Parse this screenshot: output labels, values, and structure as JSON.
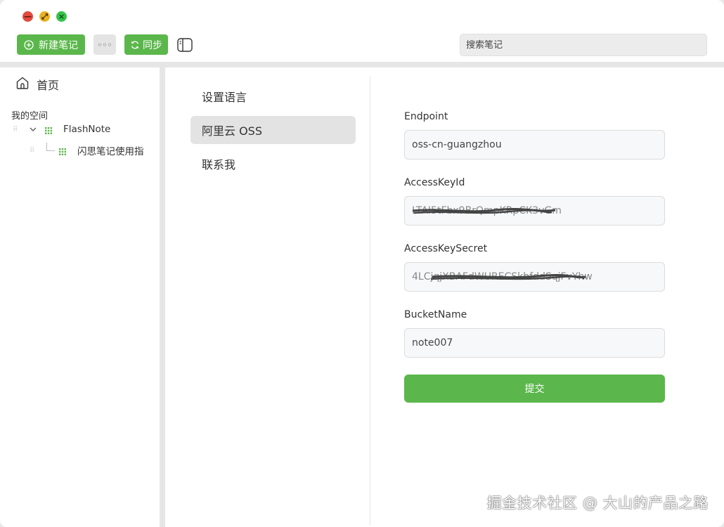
{
  "toolbar": {
    "new_note_label": "新建笔记",
    "more_label": "◦◦◦",
    "sync_label": "同步"
  },
  "search": {
    "placeholder": "搜索笔记"
  },
  "sidebar": {
    "home_label": "首页",
    "space_title": "我的空间",
    "tree": [
      {
        "label": "FlashNote",
        "expanded": true
      },
      {
        "label": "闪思笔记使用指"
      }
    ]
  },
  "settings": {
    "menu": [
      {
        "label": "设置语言"
      },
      {
        "label": "阿里云 OSS",
        "active": true
      },
      {
        "label": "联系我"
      }
    ],
    "form": {
      "endpoint_label": "Endpoint",
      "endpoint_value": "oss-cn-guangzhou",
      "access_key_id_label": "AccessKeyId",
      "access_key_id_value": "LTAI5tFbx9BrQmpKRpCK3vGm",
      "access_key_secret_label": "AccessKeySecret",
      "access_key_secret_value": "4LCjqjXBAFdWURECSkbfddSqjFvYhw",
      "bucket_name_label": "BucketName",
      "bucket_name_value": "note007",
      "submit_label": "提交"
    }
  },
  "watermark": "掘金技术社区 @ 大山的产品之路",
  "colors": {
    "accent": "#5bb74b",
    "active_menu": "#e3e3e3"
  }
}
